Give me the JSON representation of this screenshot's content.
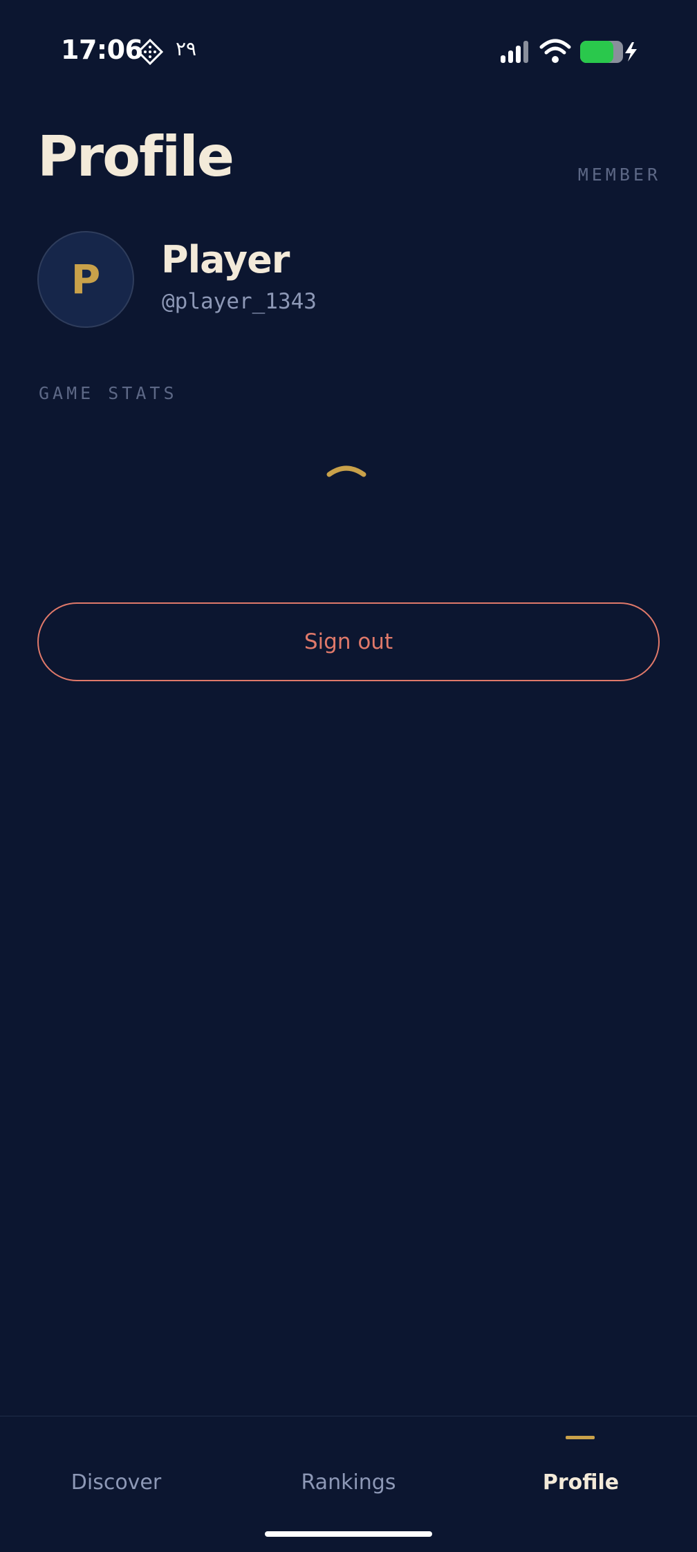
{
  "status_bar": {
    "time": "17:06",
    "date": "۲۹",
    "app_icon": "diamond-grid-icon",
    "signal_icon": "cellular-signal-icon",
    "wifi_icon": "wifi-icon",
    "battery_icon": "battery-charging-icon",
    "battery_color": "#2ac84c"
  },
  "header": {
    "title": "Profile",
    "badge": "MEMBER"
  },
  "profile": {
    "avatar_initial": "P",
    "name": "Player",
    "handle": "@player_1343"
  },
  "stats": {
    "section_label": "GAME STATS",
    "loading_icon": "loading-spinner-icon"
  },
  "actions": {
    "sign_out_label": "Sign out"
  },
  "bottom_nav": {
    "tabs": [
      {
        "label": "Discover",
        "active": false
      },
      {
        "label": "Rankings",
        "active": false
      },
      {
        "label": "Profile",
        "active": true
      }
    ]
  },
  "colors": {
    "background": "#0c1630",
    "accent_gold": "#c9a14a",
    "title_cream": "#f3ead9",
    "danger": "#e0796a",
    "muted": "#5d6886"
  }
}
